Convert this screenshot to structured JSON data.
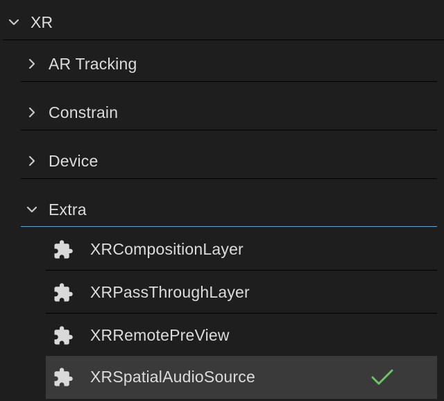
{
  "tree": {
    "root": {
      "label": "XR",
      "expanded": true
    },
    "groups": [
      {
        "label": "AR Tracking",
        "expanded": false
      },
      {
        "label": "Constrain",
        "expanded": false
      },
      {
        "label": "Device",
        "expanded": false
      },
      {
        "label": "Extra",
        "expanded": true
      }
    ],
    "extra_items": [
      {
        "label": "XRCompositionLayer",
        "icon": "puzzle-icon",
        "selected": false
      },
      {
        "label": "XRPassThroughLayer",
        "icon": "puzzle-icon",
        "selected": false
      },
      {
        "label": "XRRemotePreView",
        "icon": "puzzle-icon",
        "selected": false
      },
      {
        "label": "XRSpatialAudioSource",
        "icon": "puzzle-icon",
        "selected": true
      }
    ]
  },
  "colors": {
    "background": "#1e1e1e",
    "divider": "#000000",
    "accent_divider": "#5aa9d6",
    "selected_row": "#3a3a3a",
    "checkmark": "#6cc36a",
    "text": "#dcdcdc"
  }
}
